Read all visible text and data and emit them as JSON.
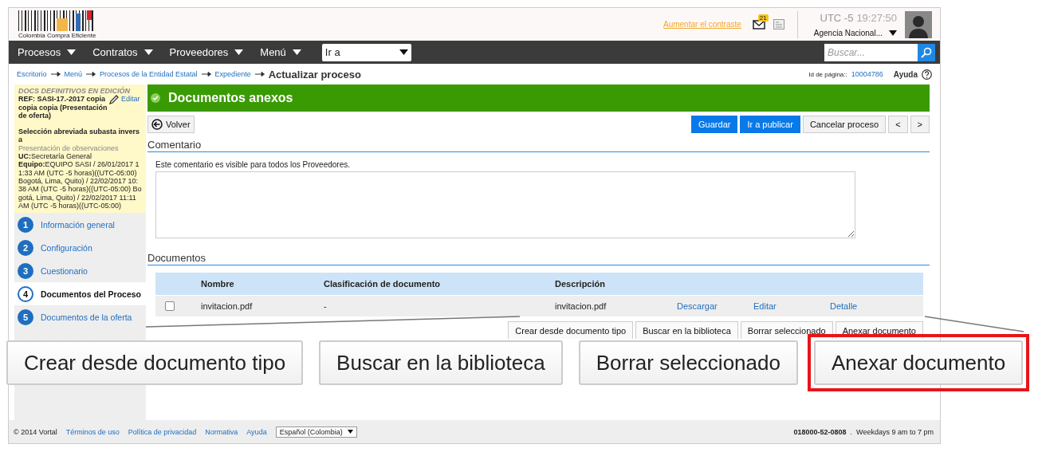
{
  "header": {
    "logo_text": "Colombia Compra Eficiente",
    "contrast_link": "Aumentar el contraste",
    "mail_count": "21",
    "timezone": "UTC -5",
    "time": "19:27:50",
    "agency": "Agencia Nacional..."
  },
  "nav": {
    "menus": [
      "Procesos",
      "Contratos",
      "Proveedores",
      "Menú"
    ],
    "goto": "Ir a",
    "search_placeholder": "Buscar..."
  },
  "breadcrumb": {
    "links": [
      "Escritorio",
      "Menú",
      "Procesos de la Entidad Estatal",
      "Expediente"
    ],
    "current": "Actualizar proceso",
    "page_id_label": "Id de página::",
    "page_id": "10004786",
    "help": "Ayuda"
  },
  "sidebar": {
    "status": "DOCS DEFINITIVOS EN EDICIÓN",
    "reference": "REF: SASI-17.-2017 copia copia copia (Presentación de oferta)",
    "edit": "Editar",
    "modality": "Selección abreviada subasta inversa",
    "phase": "Presentación de observaciones",
    "unit_label": "UC:",
    "unit": "Secretaría General",
    "team_label": "Equipo:",
    "team": "EQUIPO SASI / 26/01/2017 11:33 AM (UTC -5 horas)((UTC-05:00) Bogotá, Lima, Quito) / 22/02/2017 10:38 AM (UTC -5 horas)((UTC-05:00) Bogotá, Lima, Quito) / 22/02/2017 11:11 AM (UTC -5 horas)((UTC-05:00)",
    "steps": [
      {
        "number": "1",
        "label": "Información general",
        "selected": false
      },
      {
        "number": "2",
        "label": "Configuración",
        "selected": false
      },
      {
        "number": "3",
        "label": "Cuestionario",
        "selected": false
      },
      {
        "number": "4",
        "label": "Documentos del Proceso",
        "selected": true
      },
      {
        "number": "5",
        "label": "Documentos de la oferta",
        "selected": false
      }
    ]
  },
  "section": {
    "title": "Documentos anexos",
    "back": "Volver",
    "actions": [
      {
        "label": "Guardar",
        "kind": "primary"
      },
      {
        "label": "Ir a publicar",
        "kind": "primary"
      },
      {
        "label": "Cancelar proceso",
        "kind": "default"
      },
      {
        "label": "<",
        "kind": "default"
      },
      {
        "label": ">",
        "kind": "default"
      }
    ]
  },
  "comment": {
    "title": "Comentario",
    "note": "Este comentario es visible para todos los Proveedores."
  },
  "documents": {
    "title": "Documentos",
    "columns": [
      "Nombre",
      "Clasificación de documento",
      "Descripción"
    ],
    "rows": [
      {
        "checked": false,
        "name": "invitacion.pdf",
        "classification": "-",
        "description": "invitacion.pdf",
        "links": [
          "Descargar",
          "Editar",
          "Detalle"
        ]
      }
    ],
    "actions": [
      "Crear desde documento tipo",
      "Buscar en la biblioteca",
      "Borrar seleccionado",
      "Anexar documento"
    ]
  },
  "callout": {
    "buttons": [
      {
        "label": "Crear desde documento tipo",
        "selected": false
      },
      {
        "label": "Buscar en la biblioteca",
        "selected": false
      },
      {
        "label": "Borrar seleccionado",
        "selected": false
      },
      {
        "label": "Anexar documento",
        "selected": true
      }
    ]
  },
  "footer": {
    "copyright": "© 2014 Vortal",
    "links": [
      "Términos de uso",
      "Política de privacidad",
      "Normativa",
      "Ayuda"
    ],
    "language": "Español (Colombia)",
    "phone": "018000-52-0808",
    "separator": ".",
    "hours": "Weekdays 9 am to 7 pm"
  }
}
